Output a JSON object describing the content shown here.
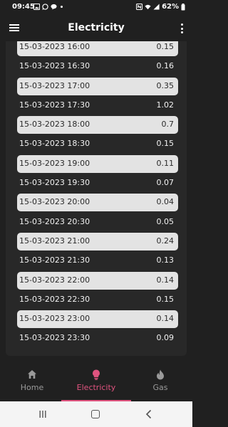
{
  "status_bar": {
    "time": "09:45",
    "battery": "62%",
    "left_icons": [
      "gallery-icon",
      "whatsapp-icon",
      "chat-icon"
    ],
    "right_icons": [
      "nfc-icon",
      "wifi-icon",
      "signal-icon",
      "battery-icon"
    ]
  },
  "app_bar": {
    "title": "Electricity",
    "menu_icon": "hamburger-menu-icon",
    "overflow_icon": "more-vert-icon"
  },
  "readings": [
    {
      "datetime": "15-03-2023 16:00",
      "value": "0.15",
      "highlight": true
    },
    {
      "datetime": "15-03-2023 16:30",
      "value": "0.16",
      "highlight": false
    },
    {
      "datetime": "15-03-2023 17:00",
      "value": "0.35",
      "highlight": true
    },
    {
      "datetime": "15-03-2023 17:30",
      "value": "1.02",
      "highlight": false
    },
    {
      "datetime": "15-03-2023 18:00",
      "value": "0.7",
      "highlight": true
    },
    {
      "datetime": "15-03-2023 18:30",
      "value": "0.15",
      "highlight": false
    },
    {
      "datetime": "15-03-2023 19:00",
      "value": "0.11",
      "highlight": true
    },
    {
      "datetime": "15-03-2023 19:30",
      "value": "0.07",
      "highlight": false
    },
    {
      "datetime": "15-03-2023 20:00",
      "value": "0.04",
      "highlight": true
    },
    {
      "datetime": "15-03-2023 20:30",
      "value": "0.05",
      "highlight": false
    },
    {
      "datetime": "15-03-2023 21:00",
      "value": "0.24",
      "highlight": true
    },
    {
      "datetime": "15-03-2023 21:30",
      "value": "0.13",
      "highlight": false
    },
    {
      "datetime": "15-03-2023 22:00",
      "value": "0.14",
      "highlight": true
    },
    {
      "datetime": "15-03-2023 22:30",
      "value": "0.15",
      "highlight": false
    },
    {
      "datetime": "15-03-2023 23:00",
      "value": "0.14",
      "highlight": true
    },
    {
      "datetime": "15-03-2023 23:30",
      "value": "0.09",
      "highlight": false
    }
  ],
  "bottom_nav": {
    "items": [
      {
        "label": "Home",
        "icon": "home-icon",
        "active": false
      },
      {
        "label": "Electricity",
        "icon": "lightbulb-icon",
        "active": true
      },
      {
        "label": "Gas",
        "icon": "flame-icon",
        "active": false
      }
    ]
  },
  "system_nav": {
    "icons": [
      "recents-icon",
      "home-circle-icon",
      "back-icon"
    ]
  },
  "colors": {
    "background": "#202020",
    "card": "#282828",
    "highlight_row": "#e3e3e3",
    "accent": "#e0537f",
    "inactive_nav": "#9a9a9a"
  }
}
